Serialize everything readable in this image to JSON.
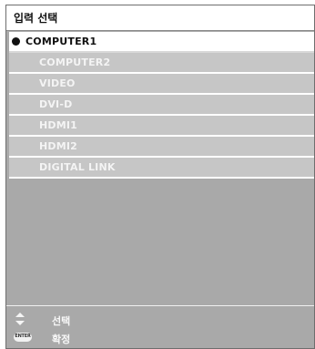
{
  "window": {
    "title": "입력 선택"
  },
  "input_list": {
    "items": [
      {
        "label": "COMPUTER1",
        "selected": true
      },
      {
        "label": "COMPUTER2",
        "selected": false
      },
      {
        "label": "VIDEO",
        "selected": false
      },
      {
        "label": "DVI-D",
        "selected": false
      },
      {
        "label": "HDMI1",
        "selected": false
      },
      {
        "label": "HDMI2",
        "selected": false
      },
      {
        "label": "DIGITAL LINK",
        "selected": false
      }
    ]
  },
  "footer": {
    "select_hint": {
      "icon": "up-down-arrows-icon",
      "label": "선택"
    },
    "confirm_hint": {
      "icon": "enter-button-icon",
      "key_text": "ENTER",
      "label": "확정"
    }
  },
  "colors": {
    "panel_background": "#a9a9a9",
    "item_background": "#c6c6c6",
    "selected_item_background": "#ffffff",
    "item_text": "#f4f4f4",
    "selected_text": "#111111"
  }
}
